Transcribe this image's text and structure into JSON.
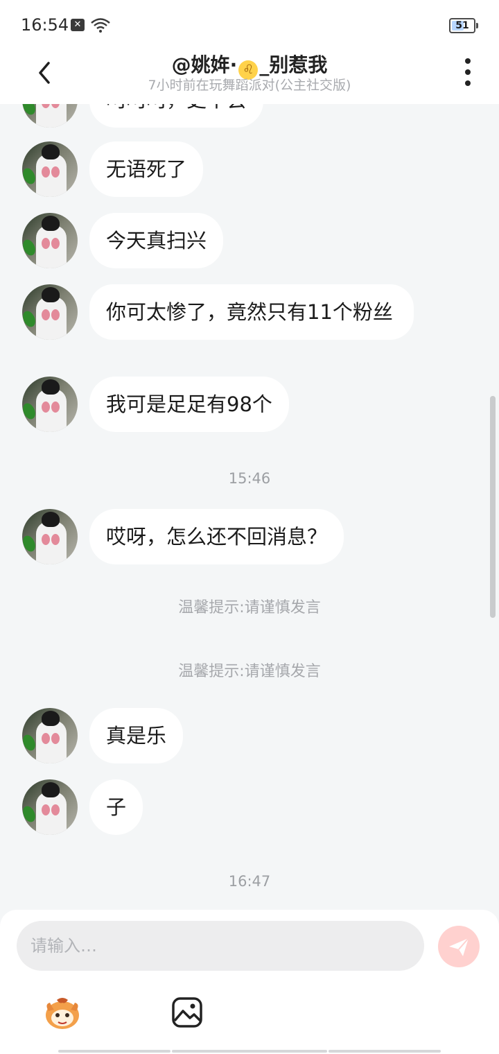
{
  "status_bar": {
    "time": "16:54",
    "battery": "51",
    "battery_level": 0.51,
    "icons": [
      "notification-x-icon",
      "wifi-icon",
      "battery-icon"
    ]
  },
  "header": {
    "title_prefix": "@姚姩·",
    "title_badge": "♌",
    "title_suffix": "_别惹我",
    "subtitle": "7小时前在玩舞蹈派对(公主社交版)",
    "icons": [
      "back-arrow-icon",
      "more-vertical-icon"
    ]
  },
  "messages": [
    {
      "text": "呵呵呵，更不会"
    },
    {
      "text": "无语死了"
    },
    {
      "text": "今天真扫兴"
    },
    {
      "text": "你可太惨了，竟然只有11个粉丝"
    },
    {
      "text": "我可是足足有98个"
    },
    {
      "text": "哎呀，怎么还不回消息？"
    },
    {
      "text": "真是乐"
    },
    {
      "text": "子"
    }
  ],
  "timestamps": [
    "15:46",
    "16:47"
  ],
  "tips": [
    "温馨提示:请谨慎发言",
    "温馨提示:请谨慎发言"
  ],
  "composer": {
    "placeholder": "请输入…",
    "icons": [
      "send-icon",
      "sticker-icon",
      "image-icon"
    ]
  },
  "colors": {
    "background": "#f4f6f7",
    "bubble": "#ffffff",
    "send_button": "#ffd1cf",
    "muted_text": "#9c9fa3"
  }
}
